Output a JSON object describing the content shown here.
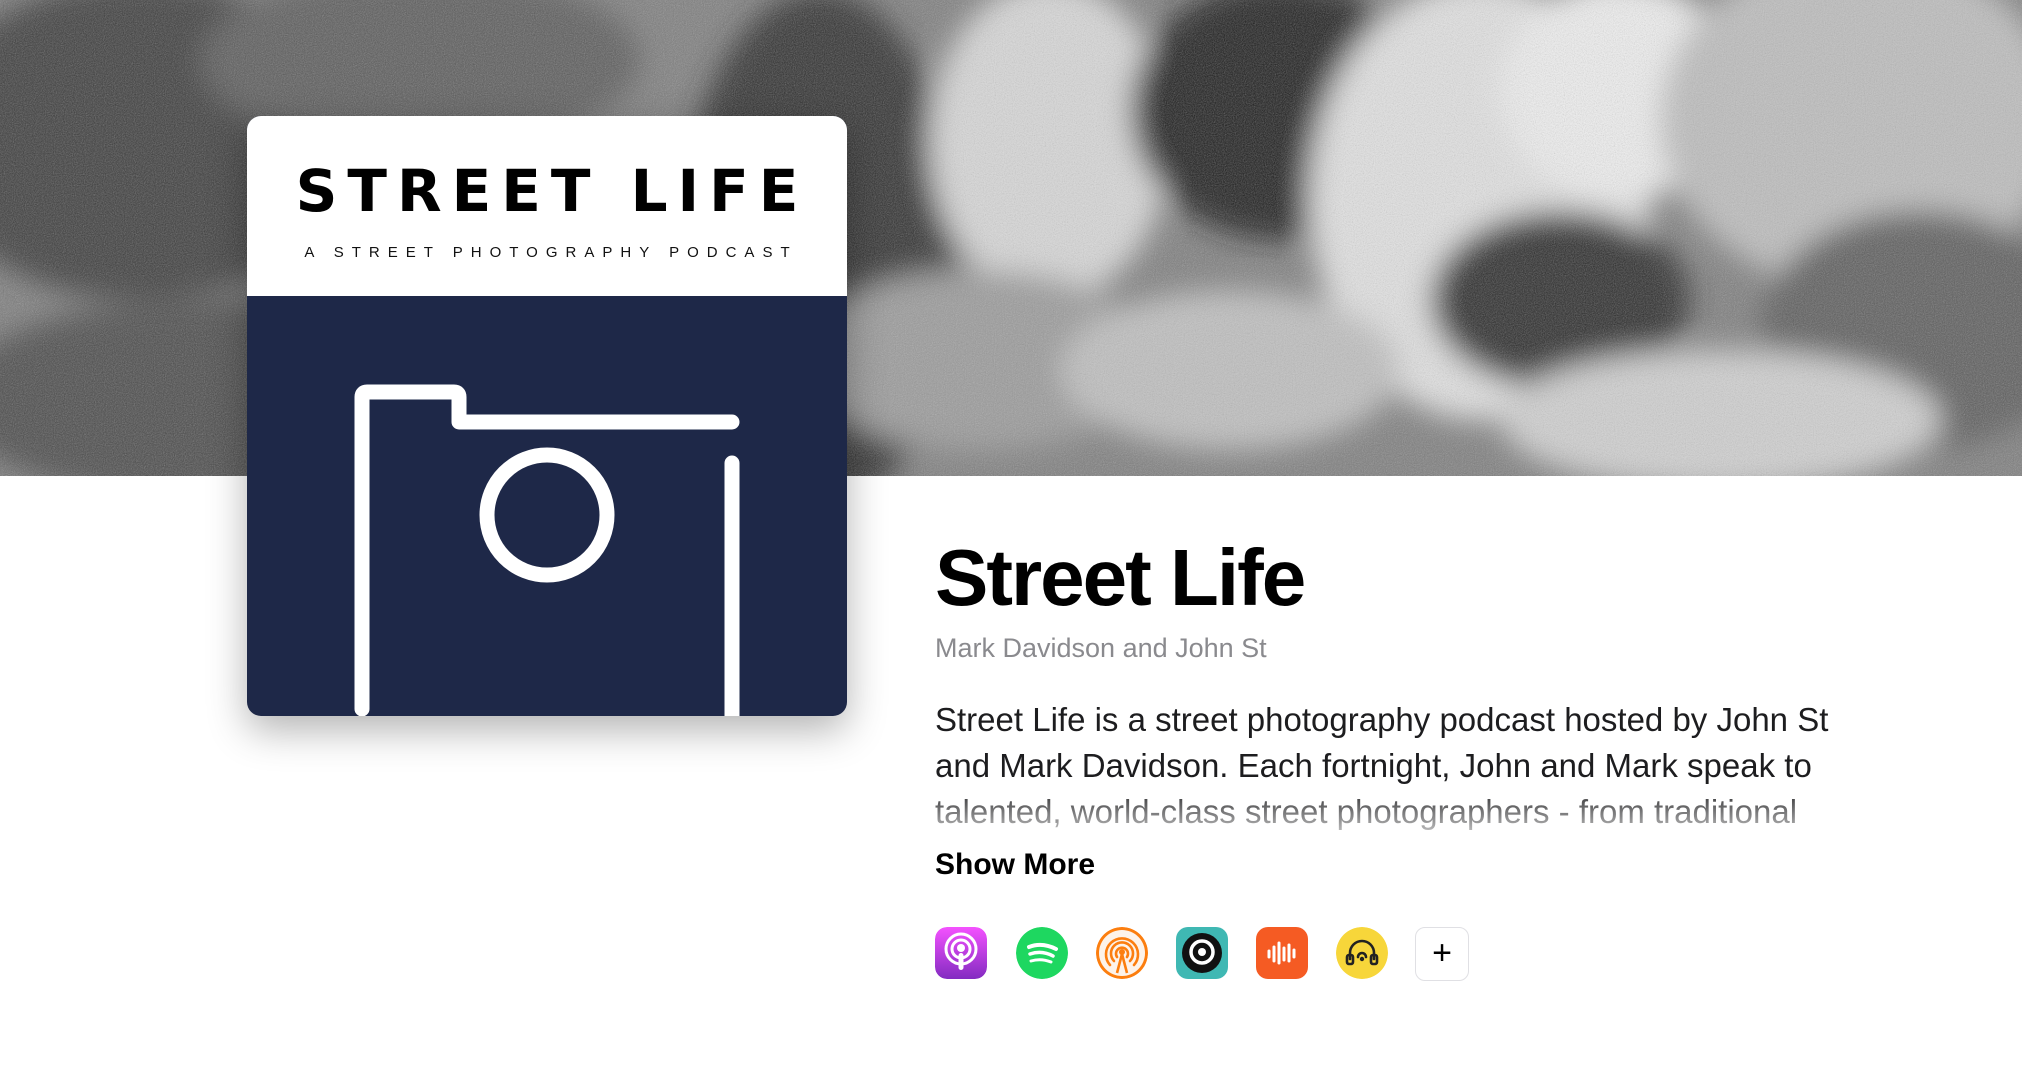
{
  "cover_art": {
    "title": "STREET LIFE",
    "subtitle": "A STREET PHOTOGRAPHY PODCAST"
  },
  "podcast": {
    "title": "Street Life",
    "author": "Mark Davidson and John St",
    "description": "Street Life is a street photography podcast hosted by John St and Mark Davidson. Each fortnight, John and Mark speak to talented, world-class street photographers - from traditional",
    "show_more_label": "Show More"
  },
  "platforms": {
    "items": [
      {
        "name": "Apple Podcasts",
        "icon": "apple-podcasts-icon",
        "color": "#a445e0"
      },
      {
        "name": "Spotify",
        "icon": "spotify-icon",
        "color": "#1ed760"
      },
      {
        "name": "Overcast",
        "icon": "overcast-icon",
        "color": "#fc7e0f"
      },
      {
        "name": "Pocket Casts",
        "icon": "pocket-casts-icon",
        "color": "#3fb8b3"
      },
      {
        "name": "Castbox",
        "icon": "castbox-icon",
        "color": "#f55b23"
      },
      {
        "name": "Podcast Addict",
        "icon": "podcast-addict-icon",
        "color": "#f7d63a"
      }
    ],
    "more_label": "+"
  },
  "colors": {
    "cover_navy": "#1e2848",
    "author_gray": "#8a8a8e"
  }
}
